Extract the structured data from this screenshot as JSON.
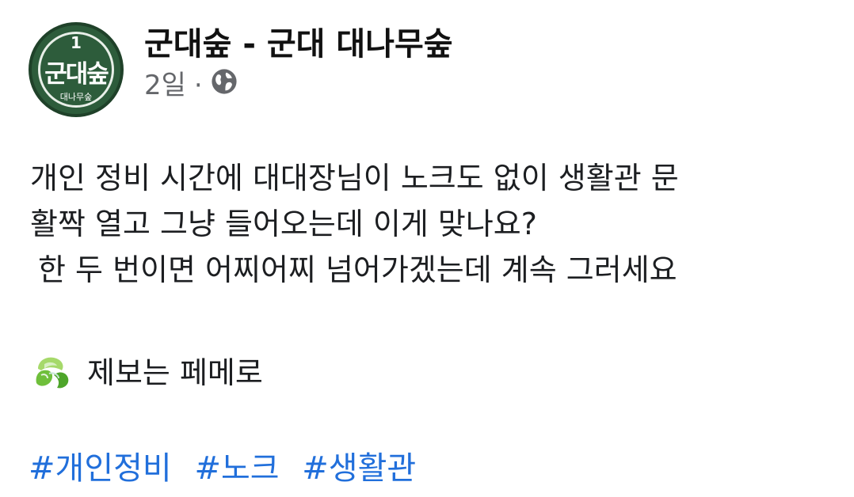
{
  "header": {
    "avatar": {
      "number": "1",
      "main_text": "군대숲",
      "sub_text": "대나무숲"
    },
    "page_name": "군대숲 - 군대 대나무숲",
    "time": "2일",
    "separator": "·",
    "audience_icon": "globe-icon"
  },
  "post": {
    "lines": [
      "개인 정비 시간에 대대장님이 노크도 없이 생활관 문",
      "활짝 열고 그냥 들어오는데 이게 맞나요?",
      "한 두 번이면 어찌어찌 넘어가겠는데 계속 그러세요"
    ],
    "source_icon": "leaf-emoji-icon",
    "source_text": "제보는 페메로"
  },
  "hashtags": [
    "#개인정비",
    "#노크",
    "#생활관"
  ],
  "colors": {
    "avatar_green": "#2d5c3b",
    "hashtag_blue": "#216fdb",
    "meta_gray": "#65676b"
  }
}
